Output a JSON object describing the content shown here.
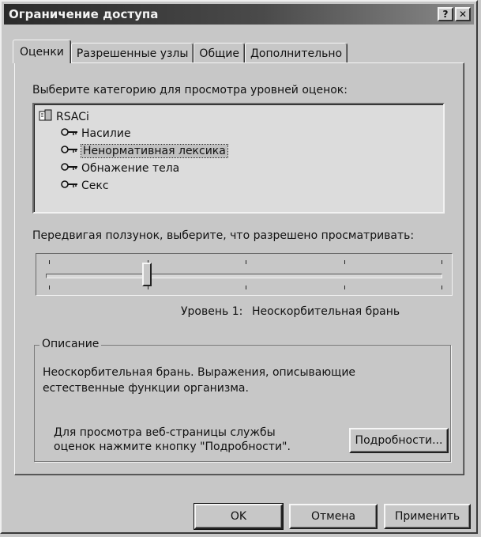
{
  "window": {
    "title": "Ограничение доступа",
    "help_button": "?",
    "close_button": "✕"
  },
  "tabs": [
    {
      "label": "Оценки",
      "active": true
    },
    {
      "label": "Разрешенные узлы",
      "active": false
    },
    {
      "label": "Общие",
      "active": false
    },
    {
      "label": "Дополнительно",
      "active": false
    }
  ],
  "category_prompt": "Выберите категорию для просмотра уровней оценок:",
  "tree": {
    "root": "RSACi",
    "items": [
      "Насилие",
      "Ненормативная лексика",
      "Обнажение тела",
      "Секс"
    ],
    "selected_item": "Ненормативная лексика"
  },
  "slider_prompt": "Передвигая ползунок, выберите, что разрешено просматривать:",
  "slider": {
    "level_index": 1,
    "max_level": 4
  },
  "level_label": "Уровень 1:",
  "level_name": "Неоскорбительная брань",
  "description": {
    "title": "Описание",
    "text_line1": "Неоскорбительная брань. Выражения, описывающие",
    "text_line2": "естественные функции организма.",
    "note_line1": "Для просмотра веб-страницы службы",
    "note_line2": "оценок нажмите кнопку \"Подробности\".",
    "details_button": "Подробности..."
  },
  "buttons": {
    "ok": "OK",
    "cancel": "Отмена",
    "apply": "Применить"
  }
}
